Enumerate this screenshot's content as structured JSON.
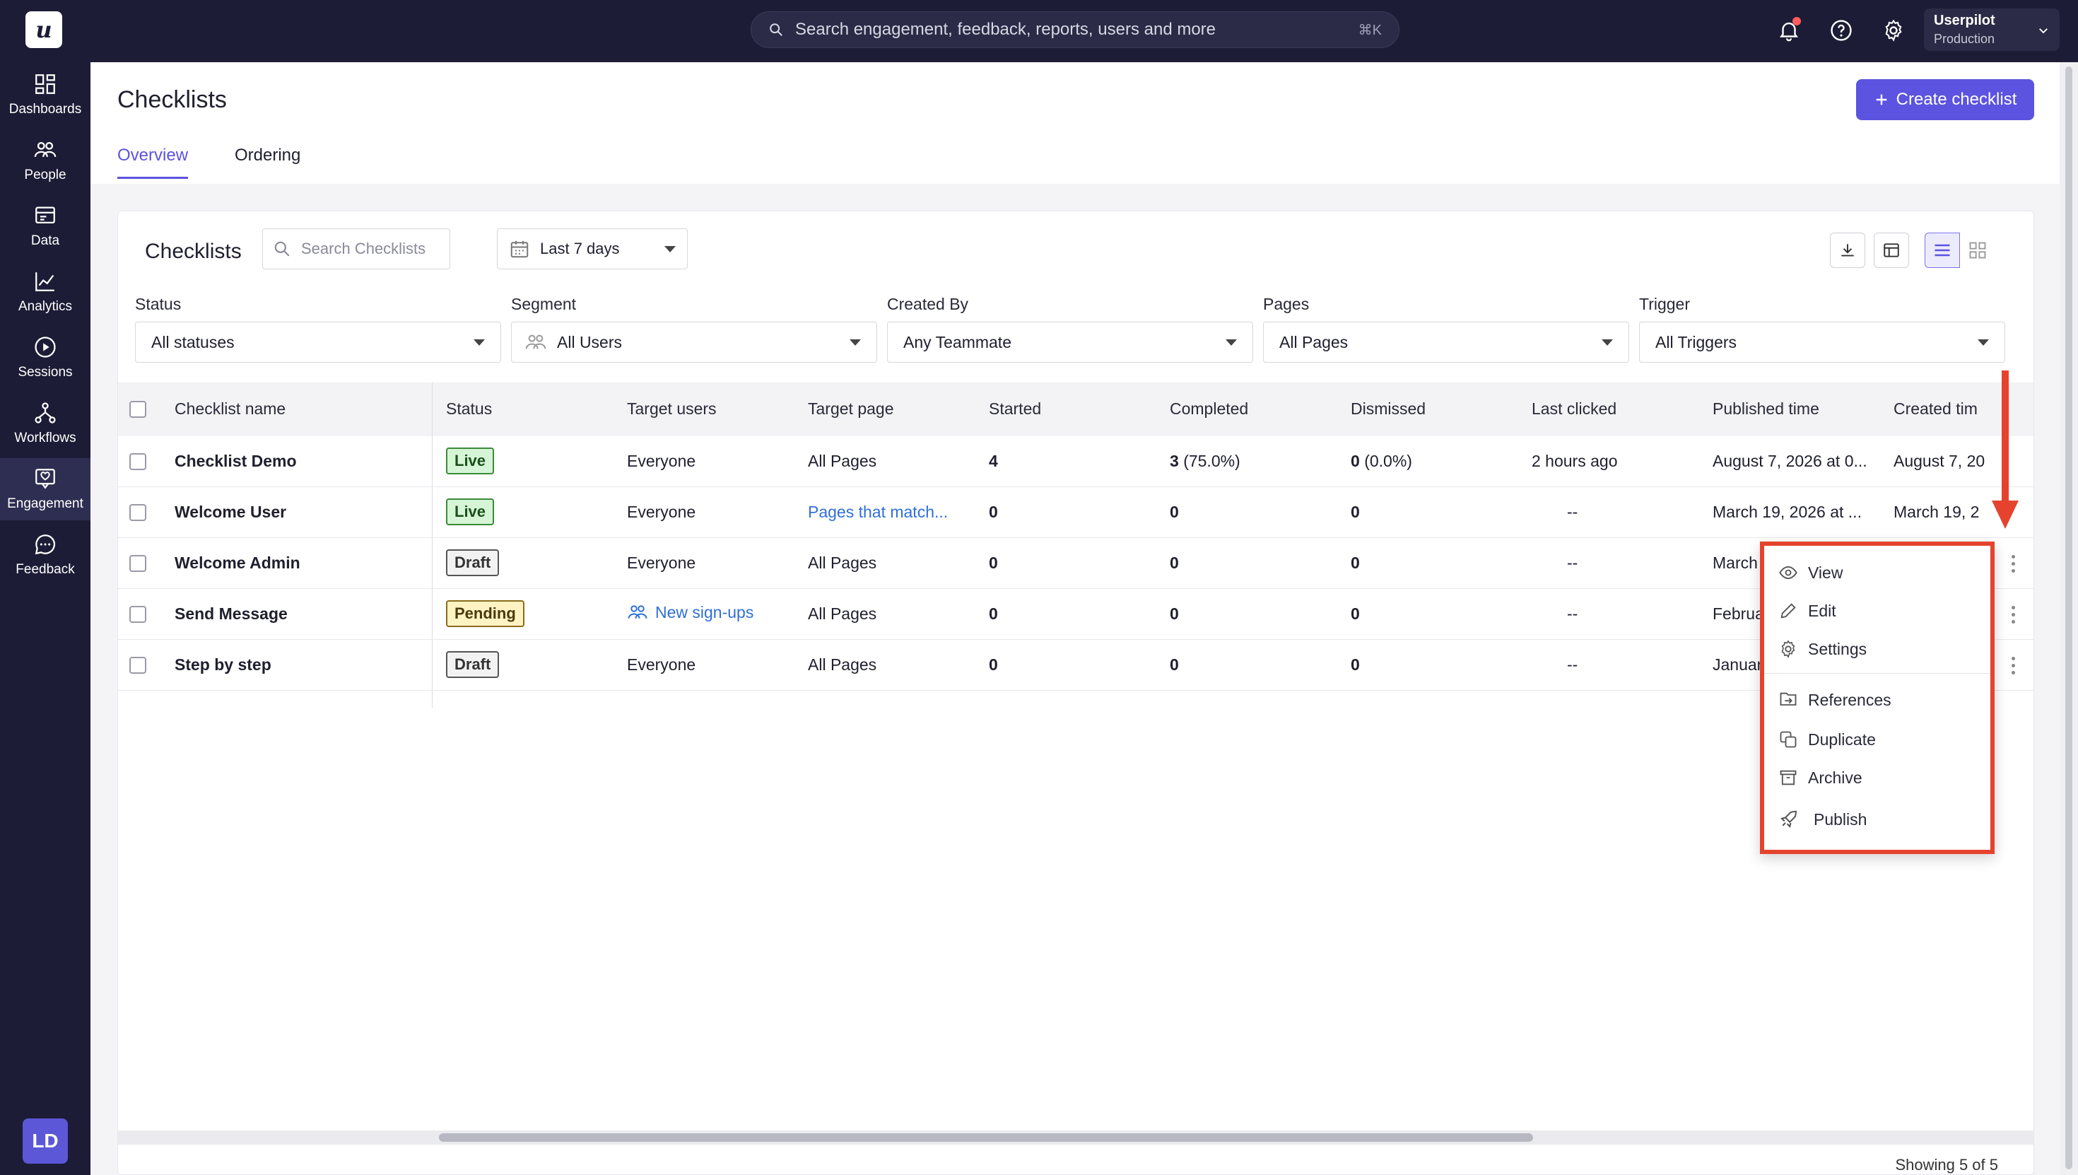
{
  "topbar": {
    "search_placeholder": "Search engagement, feedback, reports, users and more",
    "search_shortcut": "⌘K",
    "account_name": "Userpilot",
    "account_env": "Production",
    "logo_letter": "u"
  },
  "sidebar": {
    "items": [
      {
        "label": "Dashboards",
        "icon": "dashboard-icon"
      },
      {
        "label": "People",
        "icon": "people-icon"
      },
      {
        "label": "Data",
        "icon": "data-icon"
      },
      {
        "label": "Analytics",
        "icon": "analytics-icon"
      },
      {
        "label": "Sessions",
        "icon": "sessions-icon"
      },
      {
        "label": "Workflows",
        "icon": "workflows-icon"
      },
      {
        "label": "Engagement",
        "icon": "engagement-icon",
        "active": true
      },
      {
        "label": "Feedback",
        "icon": "feedback-icon"
      }
    ],
    "avatar": "LD"
  },
  "header": {
    "title": "Checklists",
    "create_label": "Create checklist",
    "tabs": [
      {
        "label": "Overview",
        "active": true
      },
      {
        "label": "Ordering"
      }
    ]
  },
  "card": {
    "title": "Checklists",
    "search_placeholder": "Search Checklists",
    "date_range": "Last 7 days",
    "filters": [
      {
        "label": "Status",
        "value": "All statuses"
      },
      {
        "label": "Segment",
        "value": "All Users"
      },
      {
        "label": "Created By",
        "value": "Any Teammate"
      },
      {
        "label": "Pages",
        "value": "All Pages"
      },
      {
        "label": "Trigger",
        "value": "All Triggers"
      }
    ]
  },
  "table": {
    "columns": [
      "Checklist name",
      "Status",
      "Target users",
      "Target page",
      "Started",
      "Completed",
      "Dismissed",
      "Last clicked",
      "Published time",
      "Created tim"
    ],
    "rows": [
      {
        "name": "Checklist Demo",
        "status": "Live",
        "target_users": "Everyone",
        "target_page": "All Pages",
        "started": "4",
        "completed": "3",
        "completed_pct": "(75.0%)",
        "dismissed": "0",
        "dismissed_pct": "(0.0%)",
        "last_clicked": "2 hours ago",
        "published": "August 7, 2026 at 0...",
        "created": "August 7, 20"
      },
      {
        "name": "Welcome User",
        "status": "Live",
        "target_users": "Everyone",
        "target_page": "Pages that match...",
        "started": "0",
        "completed": "0",
        "completed_pct": "",
        "dismissed": "0",
        "dismissed_pct": "",
        "last_clicked": "--",
        "published": "March 19, 2026 at ...",
        "created": "March 19, 2"
      },
      {
        "name": "Welcome Admin",
        "status": "Draft",
        "target_users": "Everyone",
        "target_page": "All Pages",
        "started": "0",
        "completed": "0",
        "completed_pct": "",
        "dismissed": "0",
        "dismissed_pct": "",
        "last_clicked": "--",
        "published": "March",
        "created": ""
      },
      {
        "name": "Send Message",
        "status": "Pending",
        "target_users": "New sign-ups",
        "target_page": "All Pages",
        "started": "0",
        "completed": "0",
        "completed_pct": "",
        "dismissed": "0",
        "dismissed_pct": "",
        "last_clicked": "--",
        "published": "Februa",
        "created": ""
      },
      {
        "name": "Step by step",
        "status": "Draft",
        "target_users": "Everyone",
        "target_page": "All Pages",
        "started": "0",
        "completed": "0",
        "completed_pct": "",
        "dismissed": "0",
        "dismissed_pct": "",
        "last_clicked": "--",
        "published": "Januar",
        "created": ""
      }
    ],
    "footer": "Showing 5 of 5"
  },
  "menu": {
    "items": [
      "View",
      "Edit",
      "Settings",
      "References",
      "Duplicate",
      "Archive",
      "Publish"
    ]
  },
  "colors": {
    "accent": "#5c53e0",
    "highlight": "#e5432d",
    "nav_bg": "#1c1c36"
  }
}
